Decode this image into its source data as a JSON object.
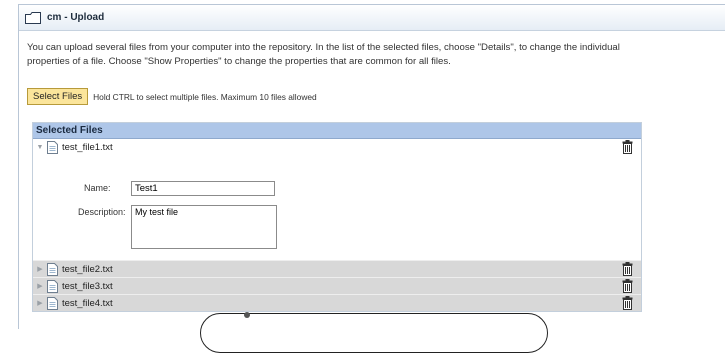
{
  "window": {
    "title": "cm - Upload"
  },
  "intro": {
    "line1": "You can upload several files from your computer into the repository. In the list of the selected files, choose \"Details\", to change the individual",
    "line2": "properties of a file. Choose \"Show Properties\" to change the properties that are common for all files."
  },
  "upload": {
    "select_label": "Select Files",
    "hint": "Hold CTRL to select multiple files. Maximum 10 files allowed"
  },
  "files": {
    "header": "Selected Files",
    "items": [
      {
        "name": "test_file1.txt",
        "expanded": true
      },
      {
        "name": "test_file2.txt",
        "expanded": false
      },
      {
        "name": "test_file3.txt",
        "expanded": false
      },
      {
        "name": "test_file4.txt",
        "expanded": false
      }
    ],
    "details": {
      "name_label": "Name:",
      "name_value": "Test1",
      "desc_label": "Description:",
      "desc_value": "My test file"
    }
  },
  "icons": {
    "folder": "folder-icon",
    "document": "document-icon",
    "trash": "trash-icon",
    "expand": "triangle-icon"
  }
}
